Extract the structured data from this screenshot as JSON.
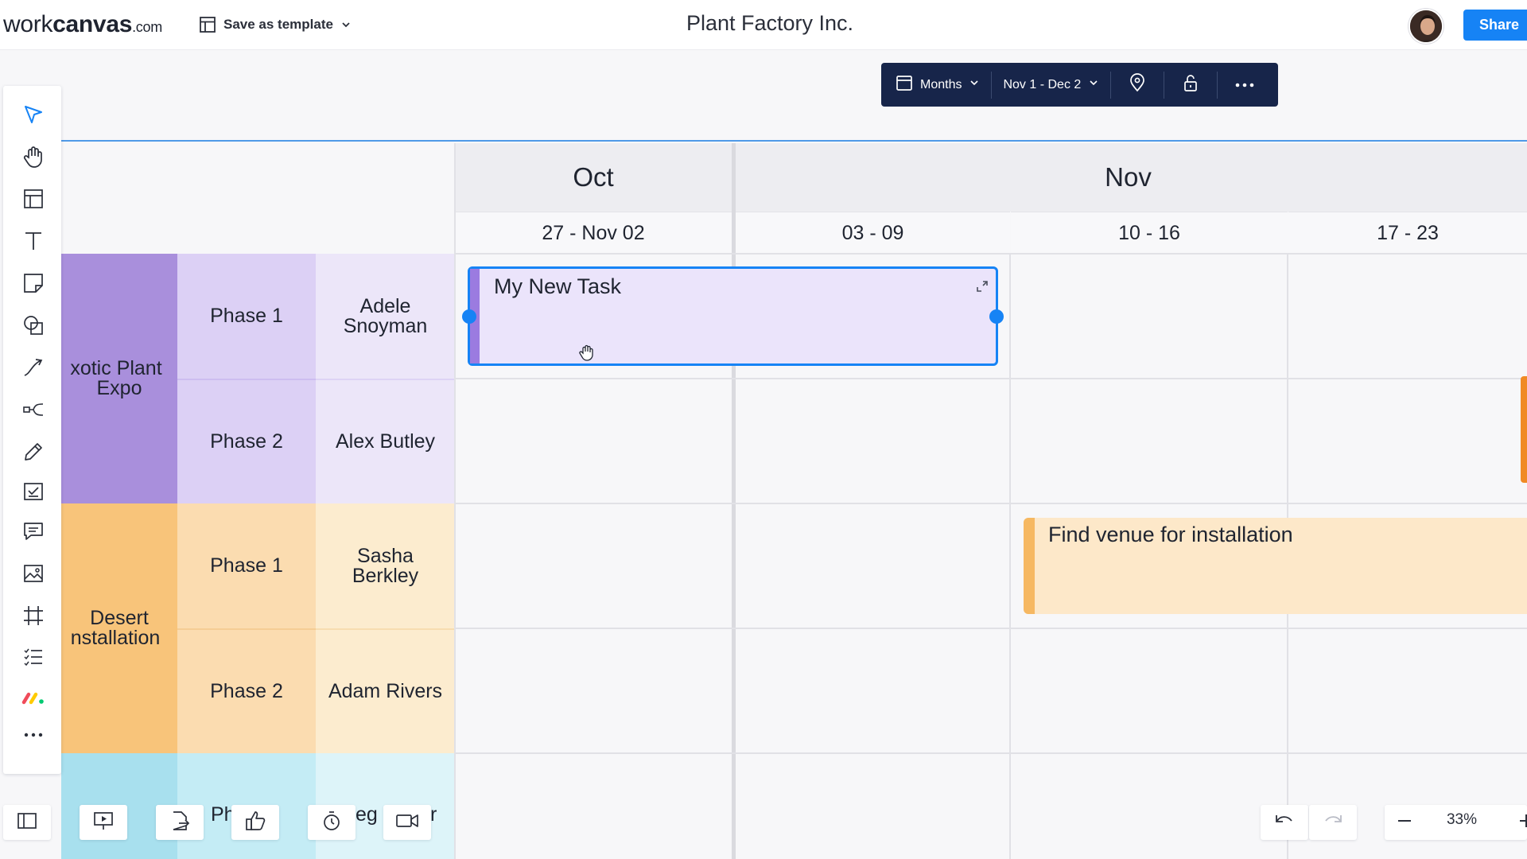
{
  "header": {
    "logo_main": "work",
    "logo_bold": "canvas",
    "logo_domain": ".com",
    "save_template_label": "Save as template",
    "document_title": "Plant Factory Inc.",
    "share_label": "Share"
  },
  "timeline_toolbar": {
    "view_label": "Months",
    "date_range": "Nov 1 - Dec 2"
  },
  "tools": [
    {
      "name": "select-tool",
      "icon": "cursor-arrow-icon"
    },
    {
      "name": "hand-tool",
      "icon": "hand-icon"
    },
    {
      "name": "table-tool",
      "icon": "table-icon"
    },
    {
      "name": "text-tool",
      "icon": "text-icon"
    },
    {
      "name": "sticky-note-tool",
      "icon": "sticky-note-icon"
    },
    {
      "name": "shapes-tool",
      "icon": "shapes-icon"
    },
    {
      "name": "connector-tool",
      "icon": "connector-arrow-icon"
    },
    {
      "name": "mind-map-tool",
      "icon": "mind-map-icon"
    },
    {
      "name": "pen-tool",
      "icon": "pencil-icon"
    },
    {
      "name": "task-tool",
      "icon": "checklist-icon"
    },
    {
      "name": "comment-tool",
      "icon": "comment-icon"
    },
    {
      "name": "image-tool",
      "icon": "image-icon"
    },
    {
      "name": "frame-tool",
      "icon": "frame-icon"
    },
    {
      "name": "list-tool",
      "icon": "numbered-list-icon"
    },
    {
      "name": "monday-tool",
      "icon": "monday-logo-icon"
    },
    {
      "name": "more-tools",
      "icon": "more-icon"
    }
  ],
  "timeline": {
    "months": [
      "Oct",
      "Nov"
    ],
    "weeks": [
      "27 - Nov 02",
      "03 - 09",
      "10 - 16",
      "17 - 23"
    ],
    "groups": [
      {
        "name": "Exotic Plant Expo",
        "label_line1": "xotic Plant",
        "label_line2": "Expo",
        "color": "#a98fdc",
        "phase_color": "#dcd0f5",
        "owner_color": "#ece6f9",
        "rows": [
          {
            "phase": "Phase 1",
            "owner_line1": "Adele",
            "owner_line2": "Snoyman"
          },
          {
            "phase": "Phase 2",
            "owner_line1": "Alex Butley",
            "owner_line2": ""
          }
        ]
      },
      {
        "name": "Desert Installation",
        "label_line1": "Desert",
        "label_line2": "nstallation",
        "color": "#f8c47a",
        "phase_color": "#fbdcb0",
        "owner_color": "#fceccf",
        "rows": [
          {
            "phase": "Phase 1",
            "owner_line1": "Sasha",
            "owner_line2": "Berkley"
          },
          {
            "phase": "Phase 2",
            "owner_line1": "Adam Rivers",
            "owner_line2": ""
          }
        ]
      }
    ],
    "partial_row": {
      "phase_partial": "Ph",
      "owner_partial_a": "eg",
      "owner_partial_b": "r"
    },
    "tasks": [
      {
        "title": "My New Task",
        "color": "#ebe4fb",
        "accent": "#9b7be0"
      },
      {
        "title": "Find venue for installation",
        "color": "#fde8c9",
        "accent": "#f6b862"
      }
    ]
  },
  "bottom_bar": {
    "zoom": "33%"
  }
}
